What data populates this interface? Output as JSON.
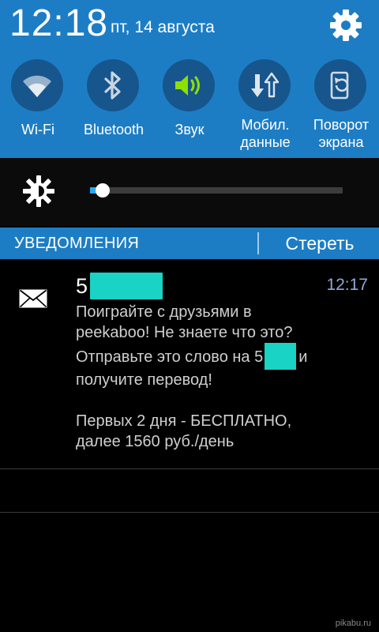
{
  "status": {
    "time": "12:18",
    "date": "пт, 14 августа",
    "settings_icon": "gear-icon"
  },
  "quick_settings": {
    "tiles": [
      {
        "id": "wifi",
        "label": "Wi-Fi",
        "icon": "wifi-icon",
        "active": false
      },
      {
        "id": "bluetooth",
        "label": "Bluetooth",
        "icon": "bluetooth-icon",
        "active": false
      },
      {
        "id": "sound",
        "label": "Звук",
        "icon": "speaker-icon",
        "active": true
      },
      {
        "id": "mobile-data",
        "label": "Мобил. данные",
        "icon": "data-transfer-icon",
        "active": false
      },
      {
        "id": "rotation",
        "label": "Поворот экрана",
        "icon": "screen-rotation-icon",
        "active": false
      }
    ],
    "active_color": "#8ee000"
  },
  "brightness": {
    "icon": "brightness-icon",
    "level": 0.05
  },
  "notifications": {
    "header_title": "УВЕДОМЛЕНИЯ",
    "clear_label": "Стереть",
    "items": [
      {
        "icon": "envelope-icon",
        "sender_prefix": "5",
        "time": "12:17",
        "body": {
          "line1": "Поиграйте с друзьями в",
          "line2": "peekaboo! Не знаете что это?",
          "line3_before": "Отправьте это слово на 5",
          "line3_after": "и",
          "line4": "получите перевод!",
          "line5": "Первых 2 дня - БЕСПЛАТНО,",
          "line6": "далее 1560 руб./день"
        }
      }
    ]
  },
  "colors": {
    "panel_blue": "#1d7dc4",
    "tile_circle": "#17558d",
    "redaction": "#19d3c5",
    "slider_fill": "#29a8ee"
  },
  "watermark": "pikabu.ru"
}
